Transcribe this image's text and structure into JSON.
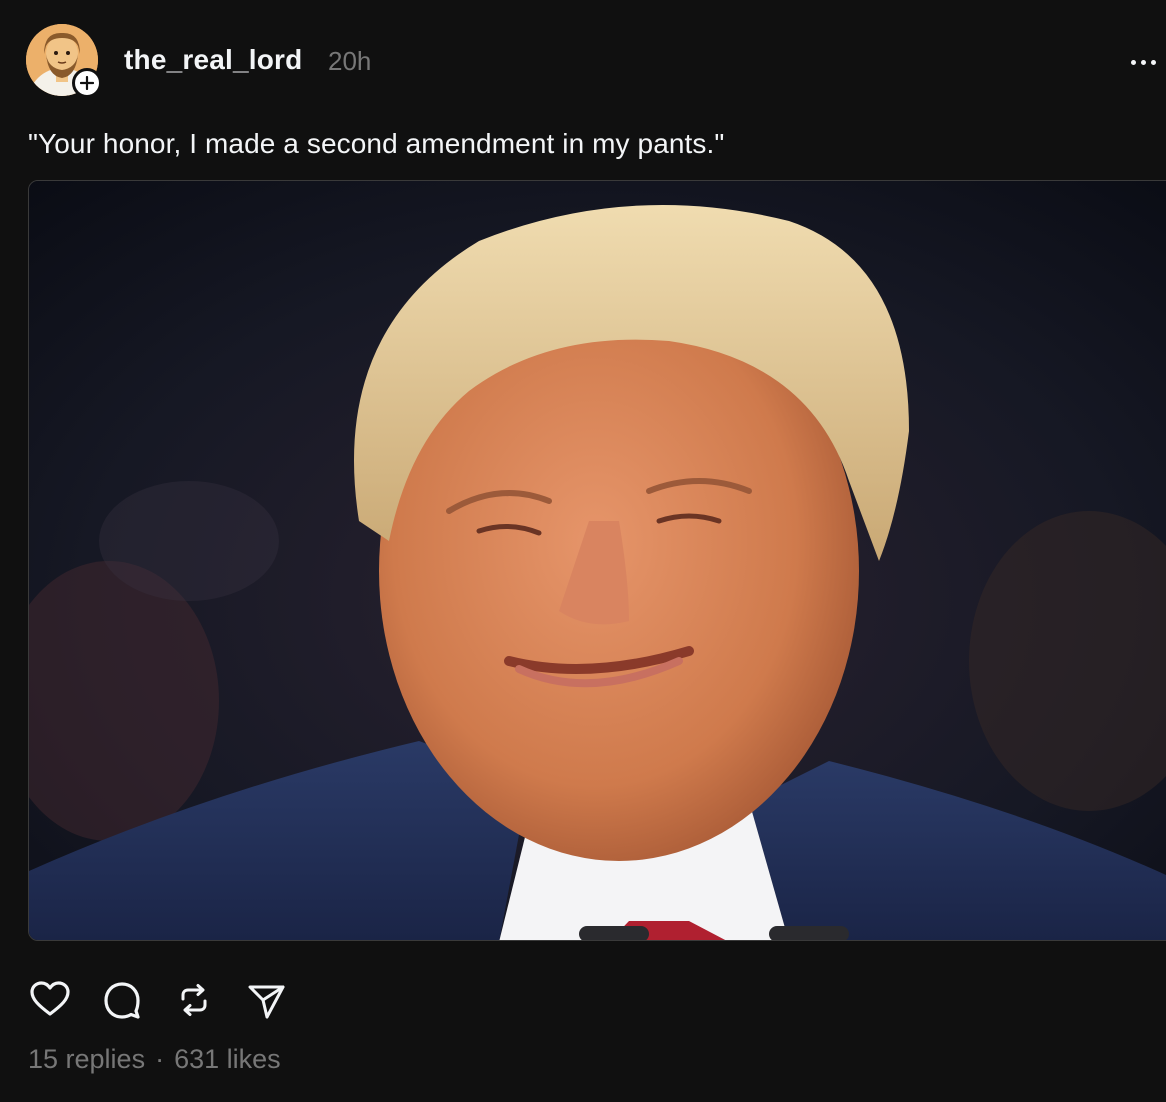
{
  "post": {
    "username": "the_real_lord",
    "time_ago": "20h",
    "caption": "\"Your honor, I made a second amendment in my pants.\"",
    "replies": "15 replies",
    "separator": "·",
    "likes": "631 likes"
  },
  "icons": {
    "more": "more-options-icon",
    "follow": "plus-icon",
    "like": "heart-icon",
    "reply": "comment-icon",
    "repost": "repost-icon",
    "share": "send-icon"
  },
  "colors": {
    "background": "#101010",
    "text_primary": "#f3f5f7",
    "text_secondary": "#777777",
    "media_border": "#3a3a3a"
  }
}
